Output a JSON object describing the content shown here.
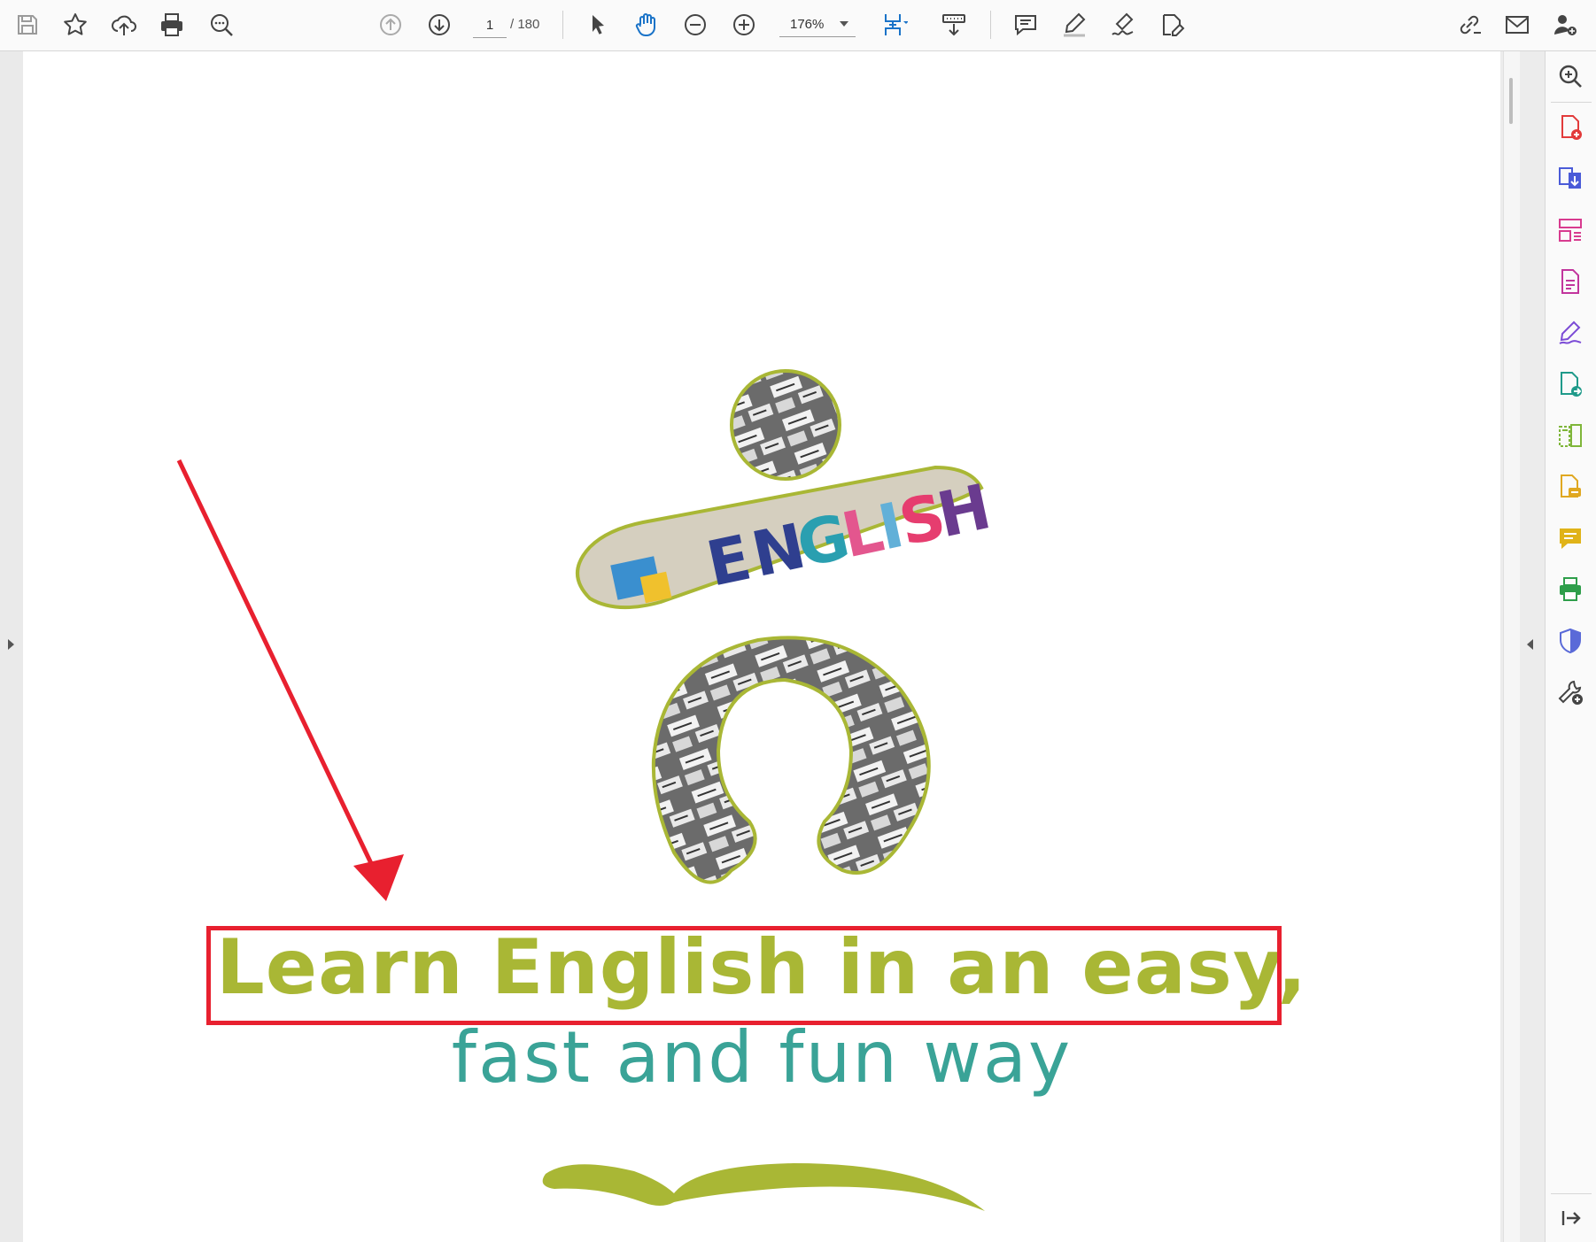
{
  "toolbar": {
    "page_current": "1",
    "page_total": "/ 180",
    "zoom": "176%",
    "tools": [
      "save-icon",
      "bookmark-star-icon",
      "cloud-upload-icon",
      "print-icon",
      "search-icon",
      "page-up-icon",
      "page-down-icon",
      "select-cursor-icon",
      "hand-icon",
      "zoom-out-icon",
      "zoom-in-icon",
      "fit-page-icon",
      "scroll-mode-icon",
      "comment-icon",
      "highlight-icon",
      "sign-icon",
      "edit-text-icon",
      "link-share-icon",
      "email-icon",
      "add-user-icon"
    ]
  },
  "document": {
    "logo_word": "ENGLISH",
    "headline": "Learn English in an easy,",
    "subline": "fast and fun way",
    "colors": {
      "headline": "#a9b735",
      "subline": "#3aa397",
      "annotation": "#e8202f",
      "logo_outline": "#a9b735"
    }
  },
  "right_pane": {
    "tools": [
      "zoom-search-icon",
      "create-pdf-icon",
      "convert-pdf-icon",
      "organize-pages-icon",
      "export-pdf-icon",
      "fill-sign-icon",
      "send-review-icon",
      "compare-files-icon",
      "request-sign-icon",
      "comment-tool-icon",
      "print-production-icon",
      "protect-shield-icon",
      "more-tools-icon",
      "collapse-pane-icon"
    ]
  }
}
